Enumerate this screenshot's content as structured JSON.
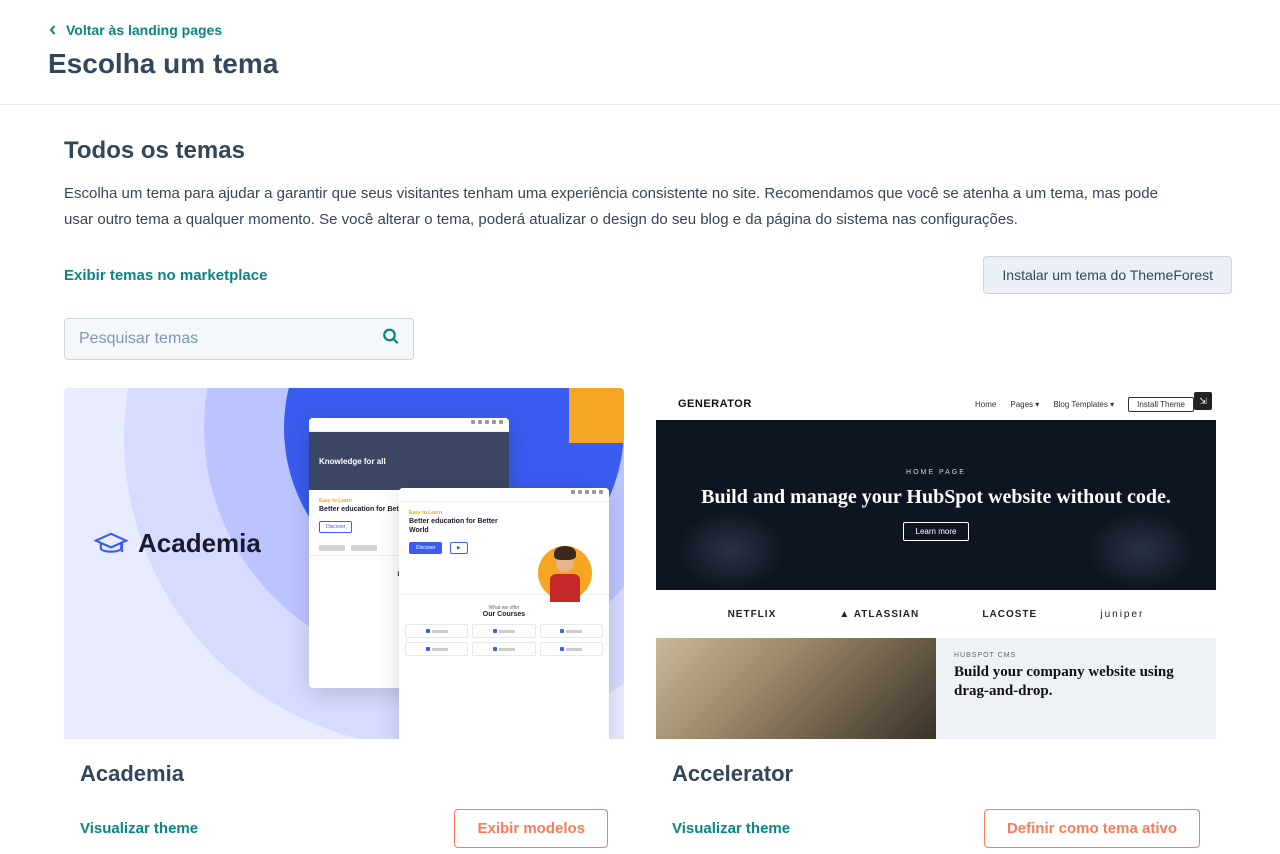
{
  "header": {
    "back_label": "Voltar às landing pages",
    "page_title": "Escolha um tema"
  },
  "section": {
    "title": "Todos os temas",
    "description": "Escolha um tema para ajudar a garantir que seus visitantes tenham uma experiência consistente no site. Recomendamos que você se atenha a um tema, mas pode usar outro tema a qualquer momento. Se você alterar o tema, poderá atualizar o design do seu blog e da página do sistema nas configurações.",
    "marketplace_link": "Exibir temas no marketplace",
    "themeforest_button": "Instalar um tema do ThemeForest"
  },
  "search": {
    "placeholder": "Pesquisar temas"
  },
  "themes": [
    {
      "title": "Academia",
      "preview_label": "Visualizar theme",
      "action_label": "Exibir modelos",
      "thumb": {
        "logo_text": "Academia",
        "win1_hero": "Knowledge for all",
        "win1_tag": "Easy to Learn",
        "win1_h": "Better education for Better World",
        "win1_btn": "Discover",
        "win2_tag": "Easy to Learn",
        "win2_h": "Better education for Better World",
        "win2_btn": "Discover",
        "win2_sub": "What we offer",
        "win2_courses": "Our Courses"
      }
    },
    {
      "title": "Accelerator",
      "preview_label": "Visualizar theme",
      "action_label": "Definir como tema ativo",
      "thumb": {
        "brand": "GENERATOR",
        "nav_home": "Home",
        "nav_pages": "Pages",
        "nav_blog": "Blog Templates",
        "nav_btn": "Install Theme",
        "hero_sub": "HOME PAGE",
        "hero_h": "Build and manage your HubSpot website without code.",
        "hero_cta": "Learn more",
        "logos": [
          "NETFLIX",
          "ATLASSIAN",
          "LACOSTE",
          "juniper"
        ],
        "split_tag": "HUBSPOT CMS",
        "split_h": "Build your company website using drag-and-drop.",
        "a11y": "⇲"
      }
    }
  ]
}
